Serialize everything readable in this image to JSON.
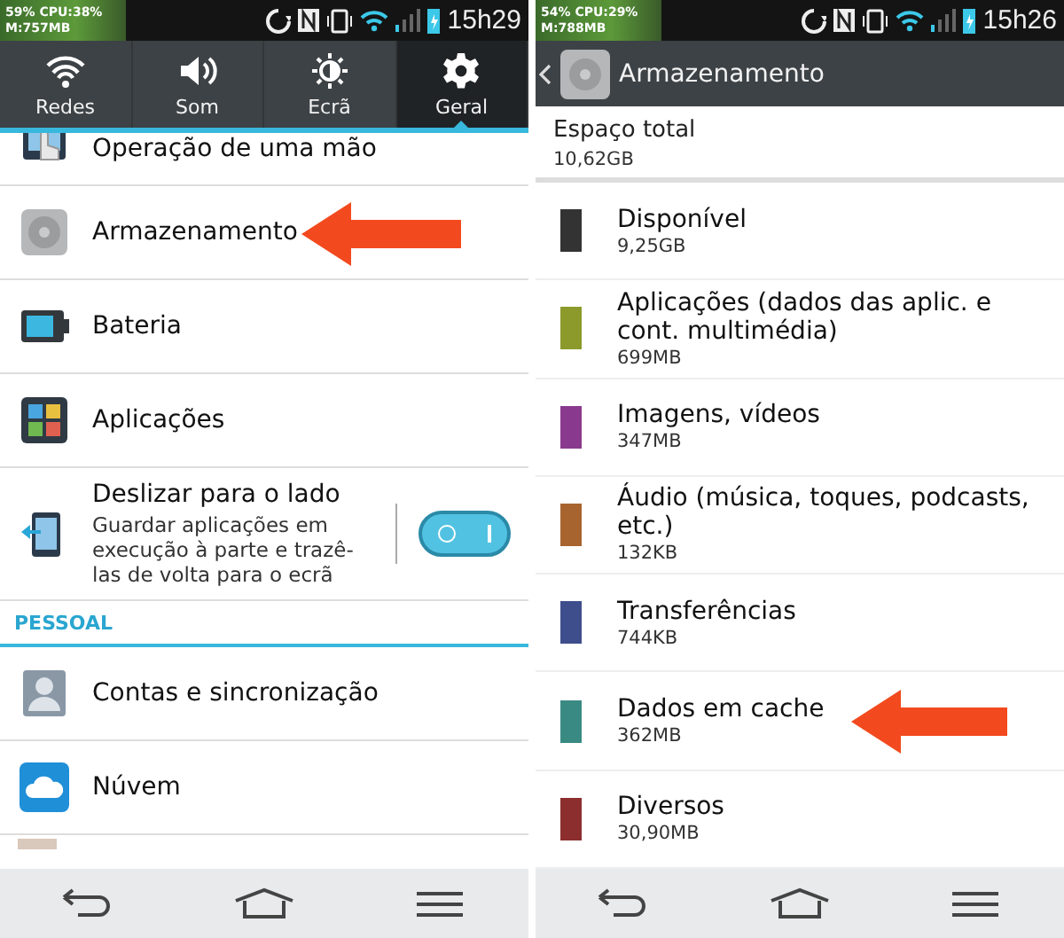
{
  "screens": [
    {
      "status_bar": {
        "memory": "M:757MB",
        "cpu": "59% CPU:38%",
        "time": "15h29"
      },
      "tabs": [
        {
          "label": "Redes",
          "selected": false
        },
        {
          "label": "Som",
          "selected": false
        },
        {
          "label": "Ecrã",
          "selected": false
        },
        {
          "label": "Geral",
          "selected": true
        }
      ],
      "items": [
        {
          "kind": "partial",
          "title": "Operação de uma mão"
        },
        {
          "kind": "item",
          "title": "Armazenamento",
          "arrow": true
        },
        {
          "kind": "item",
          "title": "Bateria"
        },
        {
          "kind": "item",
          "title": "Aplicações"
        },
        {
          "kind": "toggle",
          "title": "Deslizar para o lado",
          "subtitle": "Guardar aplicações em execução à parte e trazê-las de volta para o ecrã",
          "on": true
        },
        {
          "kind": "header",
          "title": "PESSOAL"
        },
        {
          "kind": "item",
          "title": "Contas e sincronização"
        },
        {
          "kind": "item",
          "title": "Núvem"
        },
        {
          "kind": "stub"
        }
      ]
    },
    {
      "status_bar": {
        "memory": "M:788MB",
        "cpu": "54% CPU:29%",
        "time": "15h26"
      },
      "action_bar": {
        "title": "Armazenamento"
      },
      "total": {
        "label": "Espaço total",
        "value": "10,62GB"
      },
      "categories": [
        {
          "name": "Disponível",
          "size": "9,25GB",
          "color": "#333333"
        },
        {
          "name": "Aplicações (dados das aplic. e cont. multimédia)",
          "size": "699MB",
          "color": "#8c9a2c"
        },
        {
          "name": "Imagens, vídeos",
          "size": "347MB",
          "color": "#8a3a8e"
        },
        {
          "name": "Áudio (música, toques, podcasts, etc.)",
          "size": "132KB",
          "color": "#a8642e"
        },
        {
          "name": "Transferências",
          "size": "744KB",
          "color": "#3e4e8c"
        },
        {
          "name": "Dados em cache",
          "size": "362MB",
          "color": "#3a8a84",
          "arrow": true
        },
        {
          "name": "Diversos",
          "size": "30,90MB",
          "color": "#8c2e2e"
        }
      ]
    }
  ]
}
